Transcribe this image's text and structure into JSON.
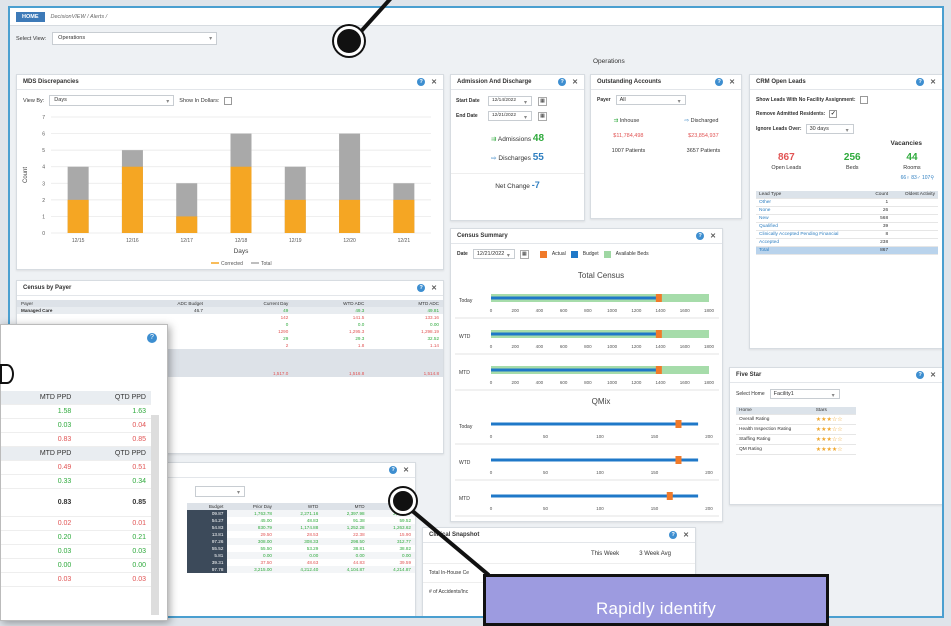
{
  "nav": {
    "home": "HOME",
    "crumb": "DecisionVIEW  /  Alerts  /"
  },
  "select_view": {
    "label": "Select View:",
    "value": "Operations"
  },
  "view_title": "Operations",
  "mds": {
    "title": "MDS Discrepancies",
    "viewby_label": "View By:",
    "viewby_value": "Days",
    "dollars_label": "Show In Dollars:",
    "ylabel": "Count",
    "xlabel": "Days",
    "legend_corrected": "Corrected",
    "legend_total": "Total"
  },
  "chart_data": {
    "type": "bar",
    "categories": [
      "12/15",
      "12/16",
      "12/17",
      "12/18",
      "12/19",
      "12/20",
      "12/21"
    ],
    "series": [
      {
        "name": "Corrected",
        "values": [
          2,
          4,
          1,
          4,
          2,
          2,
          2
        ]
      },
      {
        "name": "Total",
        "values": [
          4,
          5,
          3,
          6,
          4,
          6,
          3
        ]
      }
    ],
    "xlabel": "Days",
    "ylabel": "Count",
    "ylim": [
      0,
      7
    ],
    "yticks": [
      0,
      1,
      2,
      3,
      4,
      5,
      6,
      7
    ],
    "colors": {
      "Corrected": "#f5a623",
      "Total": "#a9a9a9"
    },
    "legend": "bottom",
    "grid": true
  },
  "adm": {
    "title": "Admission And Discharge",
    "start_label": "Start Date",
    "start": "12/14/2022",
    "end_label": "End Date",
    "end": "12/21/2022",
    "admissions_label": "Admissions",
    "admissions": "48",
    "discharges_label": "Discharges",
    "discharges": "55",
    "net_label": "Net Change",
    "net": "-7"
  },
  "accounts": {
    "title": "Outstanding Accounts",
    "payer_label": "Payer",
    "payer_value": "All",
    "inhouse_label": "Inhouse",
    "discharged_label": "Discharged",
    "inhouse_amt": "$11,784,498",
    "discharged_amt": "$23,854,937",
    "inhouse_pat": "1007 Patients",
    "discharged_pat": "3657 Patients"
  },
  "crm": {
    "title": "CRM Open Leads",
    "opt1": "Show Leads With No Facility Assignment:",
    "opt2": "Remove Admitted Residents:",
    "opt3": "Ignore Leads Over:",
    "opt3_value": "30 days",
    "vacancies": "Vacancies",
    "open_leads": "867",
    "open_leads_label": "Open Leads",
    "beds": "256",
    "beds_label": "Beds",
    "rooms": "44",
    "rooms_label": "Rooms",
    "female": "66",
    "male": "83",
    "other": "107",
    "columns": [
      "Lead Type",
      "Count",
      "Oldest Activity"
    ],
    "rows": [
      [
        "Other",
        "1",
        ""
      ],
      [
        "None",
        "26",
        ""
      ],
      [
        "New",
        "568",
        ""
      ],
      [
        "Qualified",
        "39",
        ""
      ],
      [
        "Clinically Accepted Pending Financial",
        "8",
        ""
      ],
      [
        "Accepted",
        "238",
        ""
      ],
      [
        "Total",
        "867",
        ""
      ]
    ]
  },
  "census_summary": {
    "title": "Census Summary",
    "date_label": "Date",
    "date": "12/21/2022",
    "legend_actual": "Actual",
    "legend_budget": "Budget",
    "legend_beds": "Available Beds",
    "total_title": "Total Census",
    "qmix_title": "QMix",
    "row_labels": [
      "Today",
      "WTD",
      "MTD"
    ],
    "ticks1": [
      "0",
      "200",
      "400",
      "600",
      "800",
      "1000",
      "1200",
      "1400",
      "1600",
      "1800"
    ],
    "ticks2": [
      "0",
      "50",
      "100",
      "150",
      "200"
    ]
  },
  "five_star": {
    "title": "Five Star",
    "home_label": "Select Home",
    "home_value": "Facility1",
    "col_home": "Home",
    "col_stars": "Stars",
    "rows": [
      {
        "name": "Overall Rating",
        "stars": 3
      },
      {
        "name": "Health Inspection Rating",
        "stars": 3
      },
      {
        "name": "Staffing Rating",
        "stars": 3
      },
      {
        "name": "QM Rating",
        "stars": 4
      }
    ]
  },
  "cbp": {
    "title": "Census by Payer",
    "columns": [
      "Payer",
      "ADC Budget",
      "Current Day",
      "WTD ADC",
      "MTD ADC"
    ],
    "rows": [
      [
        "Managed Care",
        "46.7",
        "49",
        "49.3",
        "49.81"
      ],
      [
        "",
        "",
        "142",
        "141.5",
        "133.16"
      ],
      [
        "",
        "",
        "0",
        "0.0",
        "0.00"
      ],
      [
        "",
        "",
        "1290",
        "1,295.3",
        "1,298.19"
      ],
      [
        "",
        "",
        "29",
        "29.3",
        "32.52"
      ],
      [
        "",
        "",
        "2",
        "1.8",
        "1.14"
      ]
    ],
    "total": [
      "",
      "",
      "1,517.0",
      "1,516.8",
      "1,514.8"
    ]
  },
  "bottom": {
    "columns": [
      "Budget",
      "Prior Day",
      "WTD",
      "MTD",
      "QTD"
    ],
    "rows": [
      [
        "09.87",
        "1,763.78",
        "2,271.16",
        "2,397.98",
        "2,452.97"
      ],
      [
        "54.27",
        "45.00",
        "48.83",
        "91.38",
        "59.52"
      ],
      [
        "54.83",
        "830.79",
        "1,174.88",
        "1,252.28",
        "1,263.62"
      ],
      [
        "13.81",
        "29.50",
        "28.53",
        "22.38",
        "15.90"
      ],
      [
        "97.26",
        "308.00",
        "308.33",
        "298.50",
        "312.77"
      ],
      [
        "55.52",
        "55.50",
        "53.29",
        "38.81",
        "38.82"
      ],
      [
        "5.81",
        "0.00",
        "0.00",
        "0.00",
        "0.00"
      ],
      [
        "39.31",
        "37.50",
        "48.63",
        "44.83",
        "39.59"
      ],
      [
        "97.78",
        "3,215.00",
        "4,212.40",
        "4,104.87",
        "4,214.87"
      ]
    ]
  },
  "clinical": {
    "title": "Clinical Snapshot",
    "this_week": "This Week",
    "three_week": "3 Week Avg",
    "row1": "Total In-House Ce",
    "row2": "# of Accidents/Inc"
  },
  "zoom": {
    "col1": "MTD PPD",
    "col2": "QTD PPD",
    "rows1": [
      [
        "1.58",
        "1.63"
      ],
      [
        "0.03",
        "0.04"
      ],
      [
        "0.83",
        "0.85"
      ]
    ],
    "rows2": [
      [
        "0.49",
        "0.51"
      ],
      [
        "0.33",
        "0.34"
      ],
      [
        "0.83",
        "0.85"
      ],
      [
        "0.02",
        "0.01"
      ],
      [
        "0.20",
        "0.21"
      ],
      [
        "0.03",
        "0.03"
      ],
      [
        "0.00",
        "0.00"
      ],
      [
        "0.03",
        "0.03"
      ]
    ]
  },
  "callout": "Rapidly identify"
}
